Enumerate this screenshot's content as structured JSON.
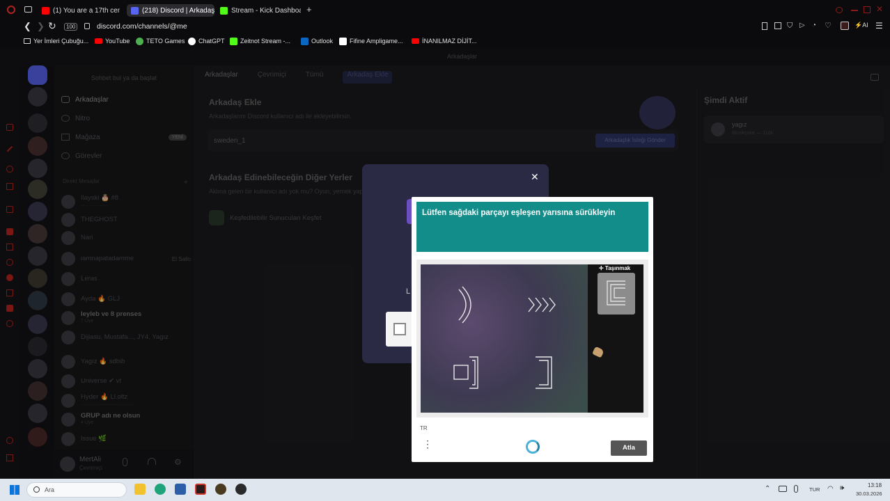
{
  "browser": {
    "tabs": [
      {
        "title": "(1) You are a 17th century",
        "favicon_color": "#ff0000"
      },
      {
        "title": "(218) Discord | Arkadaşlar",
        "favicon_color": "#5865f2"
      },
      {
        "title": "Stream - Kick Dashboard",
        "favicon_color": "#53fc18"
      }
    ],
    "new_tab": "+",
    "address": "discord.com/channels/@me",
    "zoom_badge": "100",
    "bookmarks": [
      {
        "label": "Yer İmleri Çubuğu...",
        "color": "#e0e0e0"
      },
      {
        "label": "YouTube",
        "color": "#ff0000"
      },
      {
        "label": "TETO Games",
        "color": "#4caf50"
      },
      {
        "label": "ChatGPT",
        "color": "#ffffff"
      },
      {
        "label": "Zeitnot Stream -...",
        "color": "#53fc18"
      },
      {
        "label": "Outlook",
        "color": "#0a66c2"
      },
      {
        "label": "Fifine Ampligame...",
        "color": "#ffffff"
      },
      {
        "label": "İNANILMAZ DİJİT...",
        "color": "#ff0000"
      }
    ],
    "ai_label": "AI"
  },
  "discord": {
    "window_title": "Arkadaşlar",
    "search_placeholder": "Sohbet bul ya da başlat",
    "nav": [
      {
        "label": "Arkadaşlar"
      },
      {
        "label": "Nitro"
      },
      {
        "label": "Mağaza",
        "badge": "YENİ"
      },
      {
        "label": "Görevler"
      }
    ],
    "dm_header": "Direkt Mesajlar",
    "dm_add": "+",
    "dms": [
      {
        "name": "Ilayski 🎂 #8",
        "sub": "...................."
      },
      {
        "name": "THEGHOST",
        "sub": ""
      },
      {
        "name": "Nari",
        "sub": ""
      },
      {
        "name": "iamnapatadamme",
        "sub": "",
        "status": "El Sallo"
      },
      {
        "name": "Leras",
        "sub": ""
      },
      {
        "name": "Ayda 🔥 GLJ",
        "sub": ""
      },
      {
        "name": "leyleb ve 8 prenses",
        "sub": "7 Üye",
        "bright": true
      },
      {
        "name": "Dijiasu, Mustafa..., JY4, Yagız",
        "sub": ""
      },
      {
        "name": "Yagız 🔥 sdbib",
        "sub": ""
      },
      {
        "name": "Universe ✔ vt",
        "sub": ""
      },
      {
        "name": "Hyder 🔥 Ll.oltz",
        "sub": "........................................"
      },
      {
        "name": "GRUP adı ne olsun",
        "sub": "4 Üye",
        "bright": true
      },
      {
        "name": "Issue 🌿",
        "sub": ""
      }
    ],
    "user": {
      "name": "MertAli",
      "status": "Çevrimiçi"
    },
    "top_tabs": [
      "Arkadaşlar",
      "Çevrimiçi",
      "Tümü",
      "Arkadaş Ekle"
    ],
    "add_friend": {
      "title": "Arkadaş Ekle",
      "desc": "Arkadaşlarını Discord kullanıcı adı ile ekleyebilirsin.",
      "input_value": "sweden_1",
      "button": "Arkadaşlık İsteği Gönder"
    },
    "other_places": {
      "title": "Arkadaş Edinebileceğin Diğer Yerler",
      "desc": "Aklına gelen bir kullanıcı adı yok mu? Oyun, yemek yapmak, ... sunucu listemize göz at.",
      "explore": "Keşfedilebilir Sunucuları Keşfet"
    },
    "active_now": {
      "title": "Şimdi Aktif",
      "user": "yagız",
      "activity": "Müzikçalar — 11dk"
    },
    "modal_close": "✕",
    "modal_partial_letter": "L"
  },
  "captcha": {
    "prompt": "Lütfen sağdaki parçayı eşleşen yarısına sürükleyin",
    "move_label": "✛ Taşınmak",
    "lang": "TR",
    "skip_button": "Atla",
    "teal": "#138d8a"
  },
  "taskbar": {
    "search_placeholder": "Ara",
    "lang": "TUR",
    "time": "13:18",
    "date": "30.03.2026"
  }
}
